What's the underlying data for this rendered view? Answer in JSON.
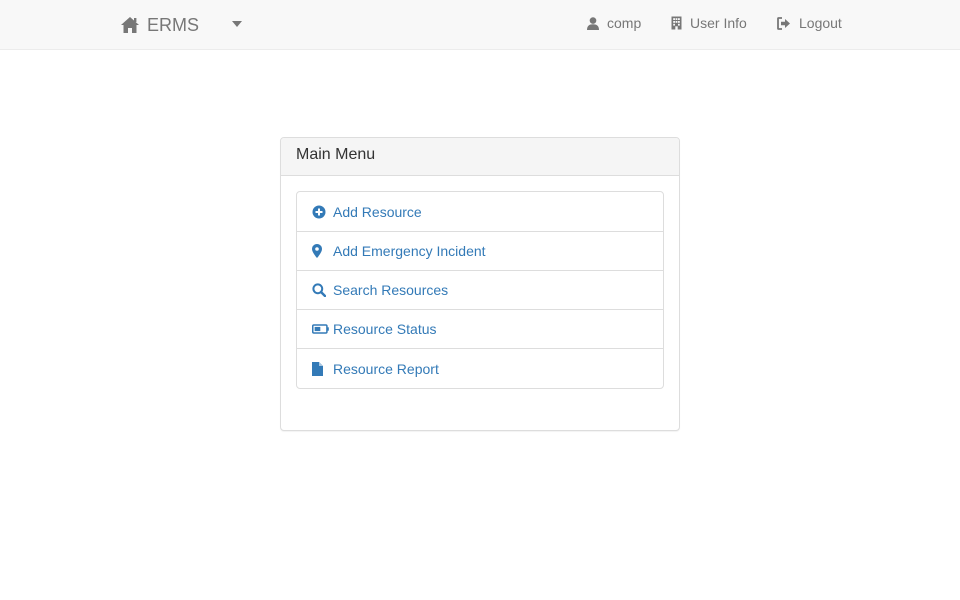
{
  "navbar": {
    "brand_label": "ERMS",
    "brand_icon": "home-icon",
    "dropdown_icon": "caret-down-icon",
    "user_label": "comp",
    "user_info_label": "User Info",
    "logout_label": "Logout",
    "text_color": "#777777",
    "background": "#f8f8f8"
  },
  "panel": {
    "title": "Main Menu",
    "items": [
      {
        "label": "Add Resource",
        "icon": "plus-circle-icon"
      },
      {
        "label": "Add Emergency Incident",
        "icon": "map-marker-icon"
      },
      {
        "label": "Search Resources",
        "icon": "search-icon"
      },
      {
        "label": "Resource Status",
        "icon": "battery-icon"
      },
      {
        "label": "Resource Report",
        "icon": "file-icon"
      }
    ],
    "link_color": "#337ab7"
  }
}
